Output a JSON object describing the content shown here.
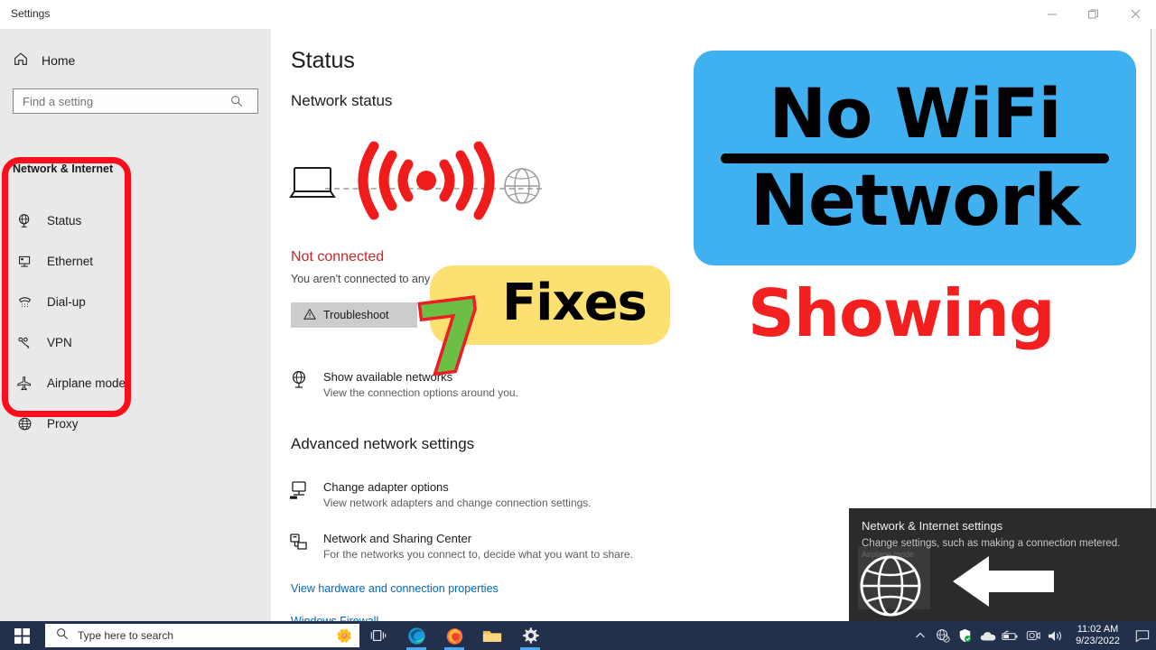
{
  "window": {
    "app_title": "Settings",
    "controls": {
      "minimize": "—",
      "restore": "❐",
      "close": "✕"
    }
  },
  "sidebar": {
    "home_label": "Home",
    "search": {
      "placeholder": "Find a setting",
      "value": "",
      "icon": "search-icon"
    },
    "heading": "Network & Internet",
    "items": [
      {
        "label": "Status",
        "icon": "network-status-icon",
        "selected": true
      },
      {
        "label": "Ethernet",
        "icon": "ethernet-icon",
        "selected": false
      },
      {
        "label": "Dial-up",
        "icon": "dialup-phone-icon",
        "selected": false
      },
      {
        "label": "VPN",
        "icon": "vpn-icon",
        "selected": false
      },
      {
        "label": "Airplane mode",
        "icon": "airplane-icon",
        "selected": false
      },
      {
        "label": "Proxy",
        "icon": "globe-icon",
        "selected": false
      }
    ],
    "highlight_color": "#fc0d1b"
  },
  "main": {
    "page_title": "Status",
    "network_status_heading": "Network status",
    "diagram": {
      "device_icon": "laptop-icon",
      "signal_icon": "wifi-arcs-icon",
      "internet_icon": "globe-icon",
      "signal_color": "#f01c1c"
    },
    "status_title": "Not connected",
    "status_title_color": "#c1272d",
    "status_subtitle": "You aren't connected to any networks.",
    "troubleshoot_button": {
      "label": "Troubleshoot",
      "icon": "warning-triangle-icon"
    },
    "show_networks": {
      "title": "Show available networks",
      "subtitle": "View the connection options around you.",
      "icon": "network-globe-icon"
    },
    "advanced_heading": "Advanced network settings",
    "advanced_rows": [
      {
        "title": "Change adapter options",
        "subtitle": "View network adapters and change connection settings.",
        "icon": "adapter-monitor-icon"
      },
      {
        "title": "Network and Sharing Center",
        "subtitle": "For the networks you connect to, decide what you want to share.",
        "icon": "sharing-center-icon"
      }
    ],
    "links": [
      "View hardware and connection properties",
      "Windows Firewall"
    ],
    "link_color": "#0067c0"
  },
  "thumbnail": {
    "title_line1": "No WiFi",
    "title_line2": "Network",
    "title_bg_color": "#3fb0f0",
    "showing_text": "Showing",
    "showing_color": "#f41f1f",
    "count_badge": "7",
    "count_color": "#6dbe45",
    "count_outline_color": "#ee1c25",
    "fixes_label": "Fixes",
    "fixes_bg_color": "#fce071"
  },
  "flyout": {
    "title": "Network & Internet settings",
    "subtitle": "Change settings, such as making a connection metered.",
    "globe_icon": "globe-icon",
    "arrow_icon": "arrow-left-icon",
    "hidden_tile_label": "Airplane mode"
  },
  "taskbar": {
    "start_icon": "windows-logo-icon",
    "search_placeholder": "Type here to search",
    "search_icon": "search-icon",
    "cortana_icon": "lotus-icon",
    "taskview_icon": "task-view-icon",
    "apps": [
      {
        "name": "edge-icon",
        "running": true
      },
      {
        "name": "firefox-icon",
        "running": true
      },
      {
        "name": "file-explorer-icon",
        "running": false
      },
      {
        "name": "settings-gear-icon",
        "running": true
      }
    ],
    "tray": [
      "chevron-up-icon",
      "network-disconnected-icon",
      "defender-shield-icon",
      "onedrive-cloud-icon",
      "battery-icon",
      "camera-icon",
      "volume-icon"
    ],
    "clock_time": "11:02 AM",
    "clock_date": "9/23/2022",
    "action_center_icon": "speech-bubble-icon"
  }
}
